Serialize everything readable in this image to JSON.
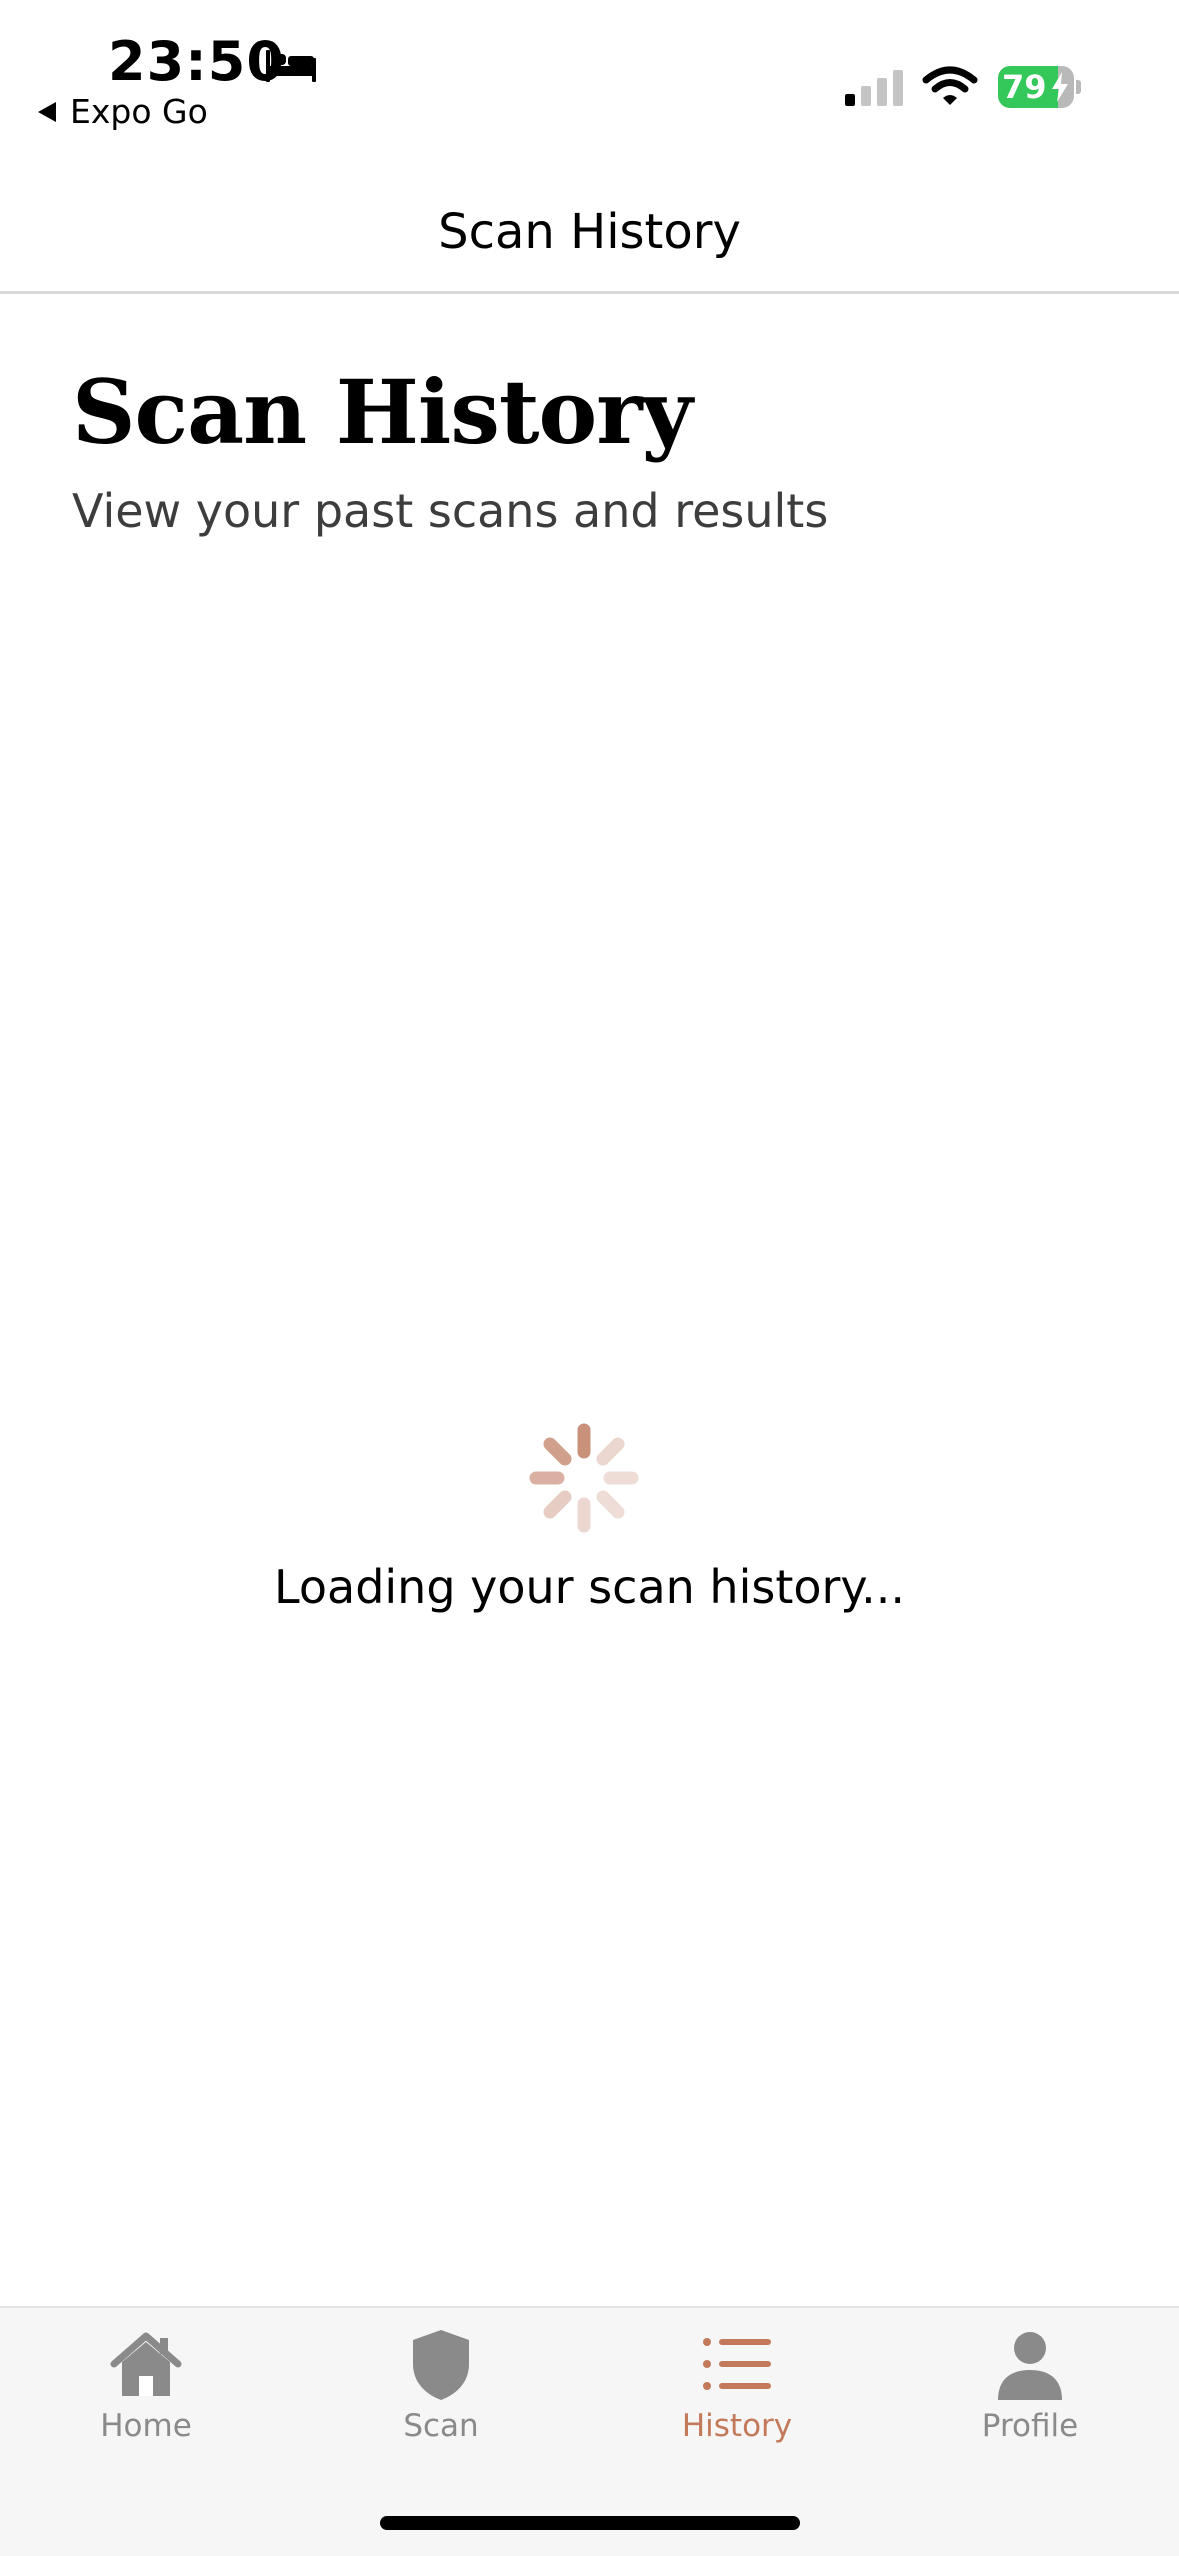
{
  "status_bar": {
    "time": "23:50",
    "back_app": "Expo Go",
    "battery_percent": "79",
    "battery_level": 0.79,
    "icons": [
      "bed-icon",
      "back-arrow-icon",
      "signal-icon",
      "wifi-icon",
      "battery-icon",
      "bolt-icon"
    ]
  },
  "nav": {
    "title": "Scan History"
  },
  "main": {
    "title": "Scan History",
    "subtitle": "View your past scans and results",
    "loading_text": "Loading your scan history..."
  },
  "tabs": [
    {
      "label": "Home",
      "icon": "home-icon",
      "active": false
    },
    {
      "label": "Scan",
      "icon": "shield-icon",
      "active": false
    },
    {
      "label": "History",
      "icon": "list-icon",
      "active": true
    },
    {
      "label": "Profile",
      "icon": "person-icon",
      "active": false
    }
  ],
  "colors": {
    "accent": "#c27a5a",
    "inactive_tab": "#8a8a8a",
    "battery_green": "#34c759",
    "spinner": "#c9907a"
  }
}
